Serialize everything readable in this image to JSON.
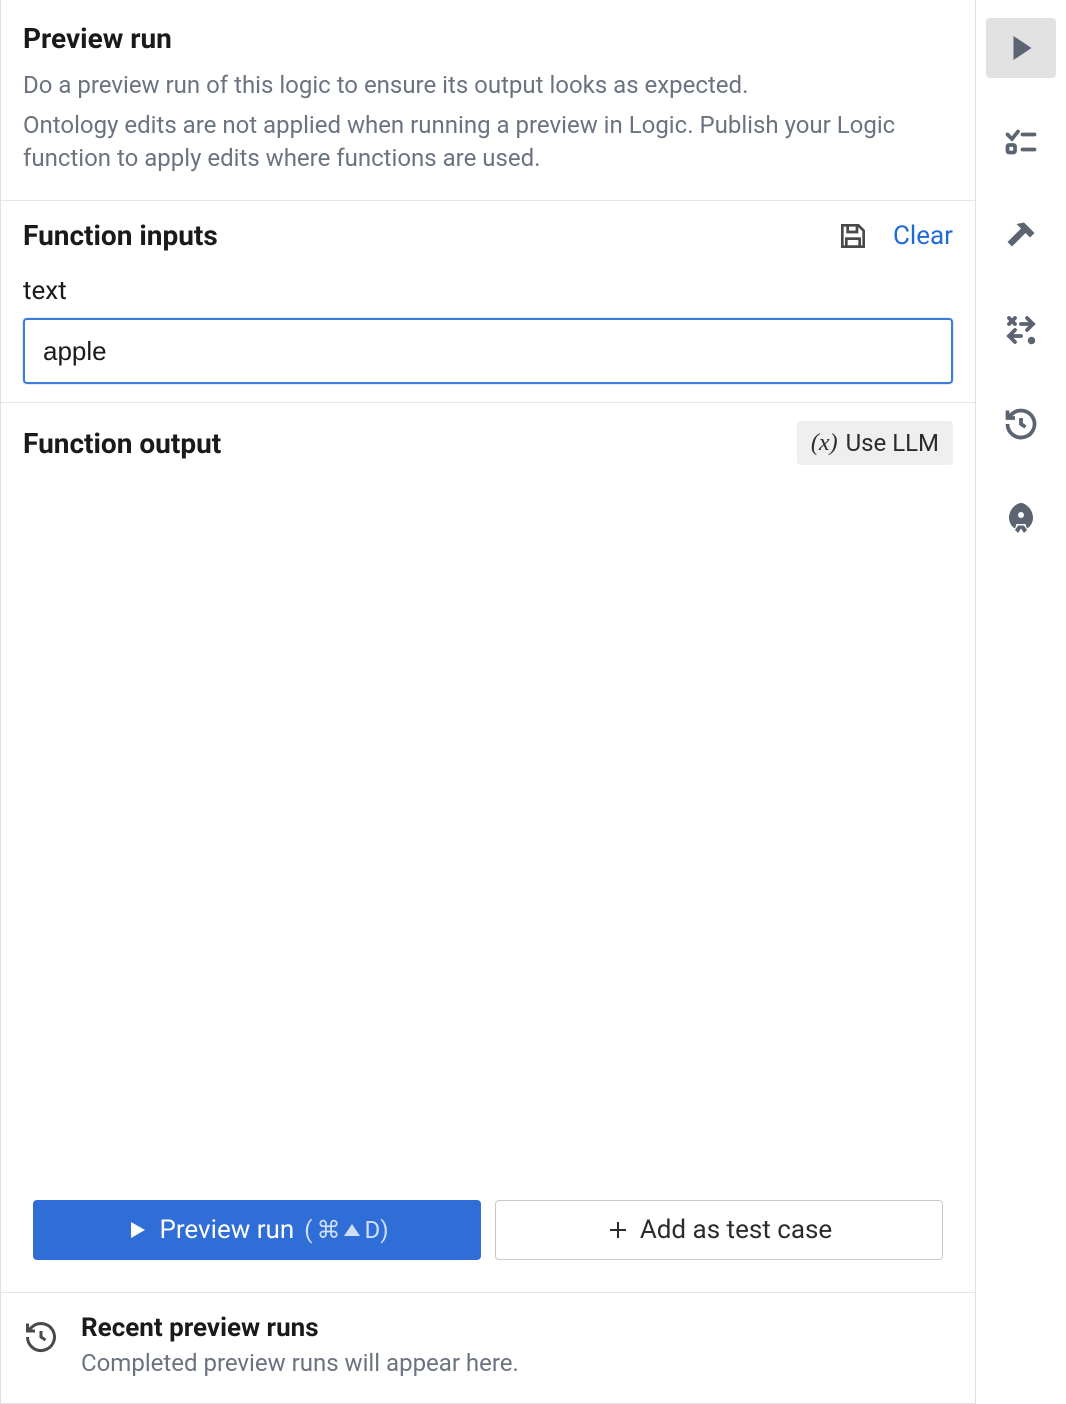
{
  "header": {
    "title": "Preview run",
    "desc1": "Do a preview run of this logic to ensure its output looks as expected.",
    "desc2": "Ontology edits are not applied when running a preview in Logic. Publish your Logic function to apply edits where functions are used."
  },
  "inputs": {
    "title": "Function inputs",
    "clear_label": "Clear",
    "fields": {
      "text": {
        "label": "text",
        "value": "apple"
      }
    }
  },
  "output": {
    "title": "Function output",
    "llm_chip_fx": "(x)",
    "llm_chip_label": "Use LLM"
  },
  "actions": {
    "preview_run_label": "Preview run",
    "preview_run_shortcut_prefix": "(",
    "preview_run_shortcut_cmd": "⌘",
    "preview_run_shortcut_letter": "D)",
    "add_test_case_label": "Add as test case"
  },
  "recent": {
    "title": "Recent preview runs",
    "desc": "Completed preview runs will appear here."
  },
  "sidebar": {
    "items": [
      {
        "name": "play"
      },
      {
        "name": "checklist"
      },
      {
        "name": "hammer"
      },
      {
        "name": "transform"
      },
      {
        "name": "history"
      },
      {
        "name": "rocket"
      }
    ]
  }
}
